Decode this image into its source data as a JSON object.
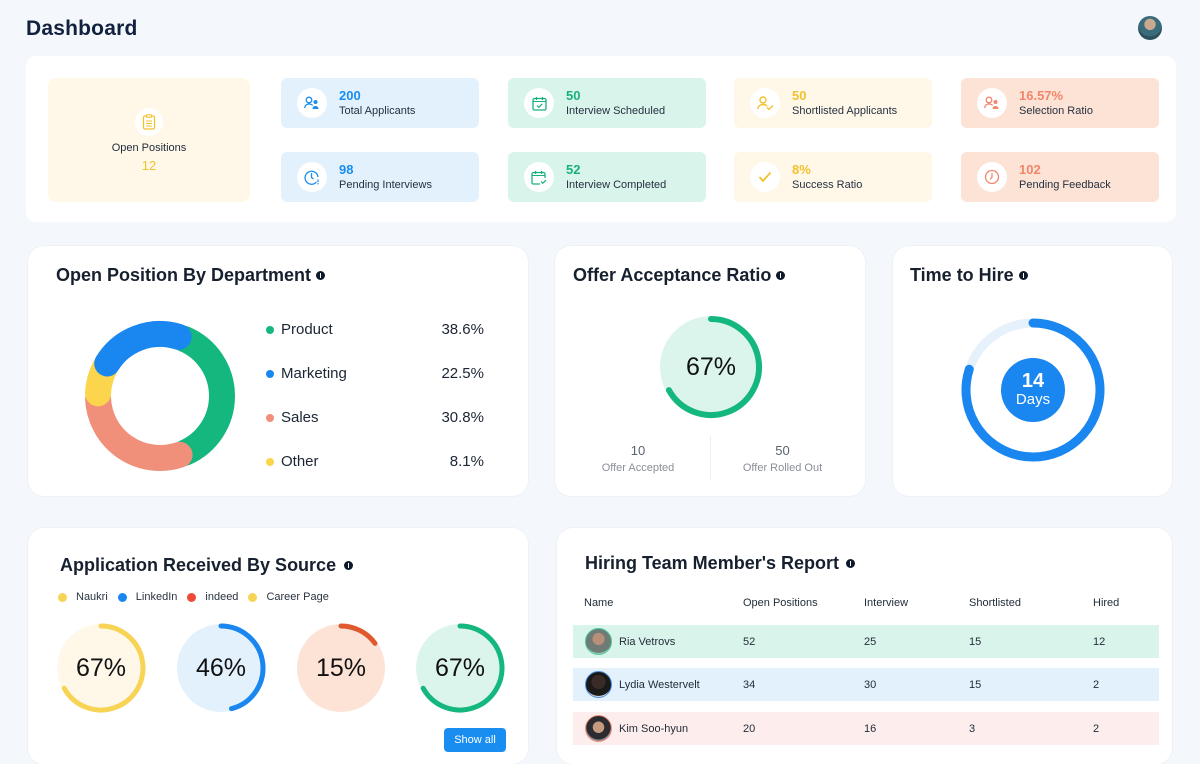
{
  "header": {
    "title": "Dashboard",
    "avatar": "user-avatar"
  },
  "stats": {
    "open_positions": {
      "label": "Open Positions",
      "value": "12",
      "icon": "clipboard-icon"
    },
    "cards": [
      {
        "value": "200",
        "label": "Total Applicants",
        "icon": "users-icon",
        "theme": "blue"
      },
      {
        "value": "50",
        "label": "Interview Scheduled",
        "icon": "calendar-check-icon",
        "theme": "green"
      },
      {
        "value": "50",
        "label": "Shortlisted Applicants",
        "icon": "user-check-icon",
        "theme": "yellow"
      },
      {
        "value": "16.57%",
        "label": "Selection Ratio",
        "icon": "users-icon",
        "theme": "orange"
      },
      {
        "value": "98",
        "label": "Pending Interviews",
        "icon": "clock-alert-icon",
        "theme": "blue"
      },
      {
        "value": "52",
        "label": "Interview Completed",
        "icon": "calendar-done-icon",
        "theme": "green"
      },
      {
        "value": "8%",
        "label": "Success Ratio",
        "icon": "check-icon",
        "theme": "yellow"
      },
      {
        "value": "102",
        "label": "Pending Feedback",
        "icon": "clock-icon",
        "theme": "orange"
      }
    ]
  },
  "department": {
    "title": "Open Position By Department",
    "items": [
      {
        "label": "Product",
        "pct": "38.6%",
        "color": "#14b77e"
      },
      {
        "label": "Marketing",
        "pct": "22.5%",
        "color": "#1a86f0"
      },
      {
        "label": "Sales",
        "pct": "30.8%",
        "color": "#f0907a"
      },
      {
        "label": "Other",
        "pct": "8.1%",
        "color": "#fbd54c"
      }
    ]
  },
  "offer": {
    "title": "Offer Acceptance Ratio",
    "value": "67%",
    "fraction": 0.67,
    "accepted": {
      "value": "10",
      "label": "Offer Accepted"
    },
    "rolled_out": {
      "value": "50",
      "label": "Offer Rolled Out"
    }
  },
  "time_to_hire": {
    "title": "Time to Hire",
    "value": "14",
    "unit": "Days",
    "fraction": 0.8
  },
  "source": {
    "title": "Application Received By Source",
    "legend": [
      {
        "label": "Naukri",
        "color": "#f7d456"
      },
      {
        "label": "LinkedIn",
        "color": "#1a86f0"
      },
      {
        "label": "indeed",
        "color": "#ef4a36"
      },
      {
        "label": "Career Page",
        "color": "#f7d456"
      }
    ],
    "gauges": [
      {
        "value": "67%",
        "fraction": 0.67,
        "color": "#f7d456",
        "bg": "#fff8e9"
      },
      {
        "value": "46%",
        "fraction": 0.46,
        "color": "#1a86f0",
        "bg": "#e3f1fd"
      },
      {
        "value": "15%",
        "fraction": 0.15,
        "color": "#e0582e",
        "bg": "#fde3d6"
      },
      {
        "value": "67%",
        "fraction": 0.67,
        "color": "#14b77e",
        "bg": "#dcf5ec"
      }
    ],
    "show_all": "Show all"
  },
  "team": {
    "title": "Hiring Team Member's Report",
    "columns": [
      "Name",
      "Open Positions",
      "Interview",
      "Shortlisted",
      "Hired"
    ],
    "rows": [
      {
        "name": "Ria Vetrovs",
        "open": "52",
        "interview": "25",
        "shortlisted": "15",
        "hired": "12",
        "bg": "#d9f4ea"
      },
      {
        "name": "Lydia Westervelt",
        "open": "34",
        "interview": "30",
        "shortlisted": "15",
        "hired": "2",
        "bg": "#e3f1fd"
      },
      {
        "name": "Kim Soo-hyun",
        "open": "20",
        "interview": "16",
        "shortlisted": "3",
        "hired": "2",
        "bg": "#fdeeed"
      }
    ]
  }
}
